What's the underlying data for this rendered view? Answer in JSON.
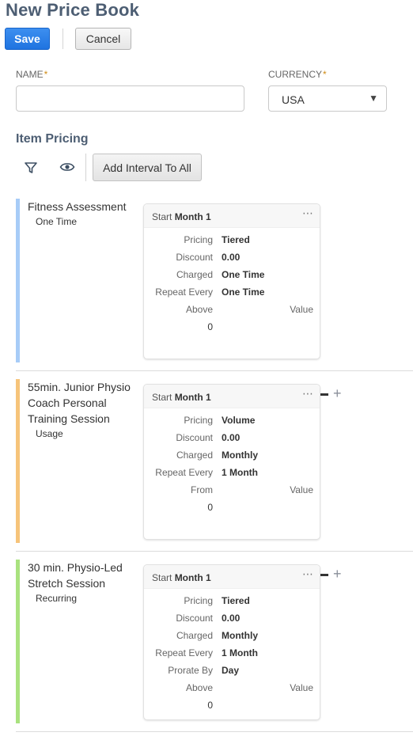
{
  "header": {
    "title": "New Price Book",
    "save_label": "Save",
    "cancel_label": "Cancel"
  },
  "form": {
    "name_label": "NAME",
    "name_required": "*",
    "name_value": "",
    "currency_label": "CURRENCY",
    "currency_required": "*",
    "currency_value": "USA"
  },
  "item_pricing": {
    "title": "Item Pricing",
    "filter_icon": "filter-icon",
    "visibility_icon": "eye-icon",
    "add_interval_label": "Add Interval To All"
  },
  "items": [
    {
      "name": "Fitness Assessment",
      "type": "One Time",
      "accent_color": "#a7ccf7",
      "card": {
        "start_label": "Start",
        "start_value": "Month 1",
        "fields": [
          {
            "label": "Pricing",
            "value": "Tiered"
          },
          {
            "label": "Discount",
            "value": "0.00"
          },
          {
            "label": "Charged",
            "value": "One Time"
          },
          {
            "label": "Repeat Every",
            "value": "One Time"
          }
        ],
        "tier_header": "Above",
        "value_header": "Value",
        "tier_value": "0"
      }
    },
    {
      "name": "55min. Junior Physio Coach Personal Training Session",
      "type": "Usage",
      "accent_color": "#f6c47a",
      "card": {
        "start_label": "Start",
        "start_value": "Month 1",
        "fields": [
          {
            "label": "Pricing",
            "value": "Volume"
          },
          {
            "label": "Discount",
            "value": "0.00"
          },
          {
            "label": "Charged",
            "value": "Monthly"
          },
          {
            "label": "Repeat Every",
            "value": "1 Month"
          }
        ],
        "tier_header": "From",
        "value_header": "Value",
        "tier_value": "0"
      }
    },
    {
      "name": "30 min. Physio-Led Stretch Session",
      "type": "Recurring",
      "accent_color": "#a9e27f",
      "card": {
        "start_label": "Start",
        "start_value": "Month 1",
        "fields": [
          {
            "label": "Pricing",
            "value": "Tiered"
          },
          {
            "label": "Discount",
            "value": "0.00"
          },
          {
            "label": "Charged",
            "value": "Monthly"
          },
          {
            "label": "Repeat Every",
            "value": "1 Month"
          },
          {
            "label": "Prorate By",
            "value": "Day"
          }
        ],
        "tier_header": "Above",
        "value_header": "Value",
        "tier_value": "0"
      }
    }
  ],
  "icons": {
    "more": "⋯",
    "add": "+",
    "caret": "▼"
  }
}
